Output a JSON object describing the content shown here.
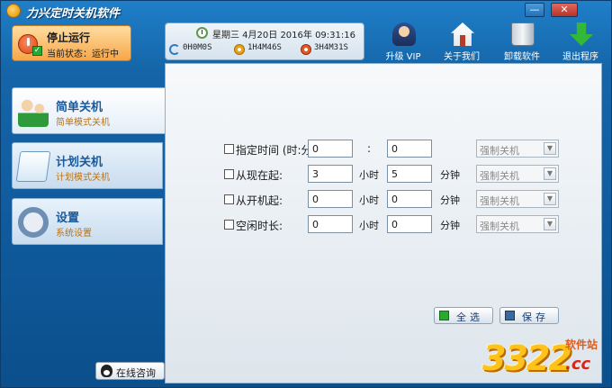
{
  "app": {
    "title": "力兴定时关机软件",
    "min": "—",
    "close": "✕"
  },
  "stop": {
    "label": "停止运行",
    "status": "当前状态：运行中"
  },
  "info": {
    "datetime": "星期三 4月20日 2016年 09:31:16",
    "t1": "0H0M0S",
    "t2": "1H4M46S",
    "t3": "3H4M31S"
  },
  "toolbar": [
    {
      "label": "升级 VIP",
      "icon": "vip-user-icon"
    },
    {
      "label": "关于我们",
      "icon": "home-icon"
    },
    {
      "label": "卸载软件",
      "icon": "recycle-bin-icon"
    },
    {
      "label": "退出程序",
      "icon": "exit-arrow-icon"
    }
  ],
  "nav": [
    {
      "title": "简单关机",
      "sub": "简单模式关机"
    },
    {
      "title": "计划关机",
      "sub": "计划模式关机"
    },
    {
      "title": "设置",
      "sub": "系统设置"
    }
  ],
  "online": {
    "label": "在线咨询"
  },
  "rows": [
    {
      "label": "指定时间 (时:分):",
      "a": "0",
      "sep": ":",
      "b": "0",
      "mode": "强制关机"
    },
    {
      "label": "从现在起:",
      "a": "3",
      "unit_h": "小时",
      "b": "5",
      "unit_m": "分钟",
      "mode": "强制关机"
    },
    {
      "label": "从开机起:",
      "a": "0",
      "unit_h": "小时",
      "b": "0",
      "unit_m": "分钟",
      "mode": "强制关机"
    },
    {
      "label": "空闲时长:",
      "a": "0",
      "unit_h": "小时",
      "b": "0",
      "unit_m": "分钟",
      "mode": "强制关机"
    }
  ],
  "buttons": {
    "select_all": "全选",
    "save": "保存"
  },
  "watermark": {
    "digits": "3322",
    "text": "软件站",
    "domain": ".cc"
  }
}
